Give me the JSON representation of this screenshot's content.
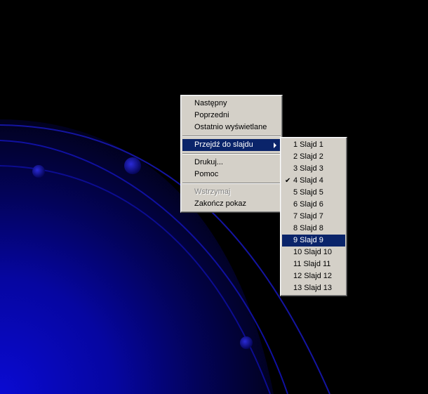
{
  "background": {
    "color_dark": "#000000",
    "color_accent": "#0000c8",
    "color_lines": "#1a1aa8"
  },
  "context_menu": {
    "items": [
      {
        "label": "Następny",
        "enabled": true
      },
      {
        "label": "Poprzedni",
        "enabled": true
      },
      {
        "label": "Ostatnio wyświetlane",
        "enabled": true
      },
      {
        "label": "Przejdź do slajdu",
        "enabled": true,
        "submenu": true,
        "highlighted": true
      },
      {
        "label": "Drukuj...",
        "enabled": true
      },
      {
        "label": "Pomoc",
        "enabled": true
      },
      {
        "label": "Wstrzymaj",
        "enabled": false
      },
      {
        "label": "Zakończ pokaz",
        "enabled": true
      }
    ]
  },
  "slide_submenu": {
    "checked_index": 3,
    "highlighted_index": 8,
    "items": [
      "1 Slajd 1",
      "2 Slajd 2",
      "3 Slajd 3",
      "4 Slajd 4",
      "5 Slajd 5",
      "6 Slajd 6",
      "7 Slajd 7",
      "8 Slajd 8",
      "9 Slajd 9",
      "10 Slajd 10",
      "11 Slajd 11",
      "12 Slajd 12",
      "13 Slajd 13"
    ]
  },
  "icons": {
    "submenu_arrow": "chevron-right-icon",
    "check": "check-icon"
  },
  "colors": {
    "menu_face": "#d4d0c8",
    "highlight": "#0a246a",
    "disabled_text": "#808080"
  }
}
